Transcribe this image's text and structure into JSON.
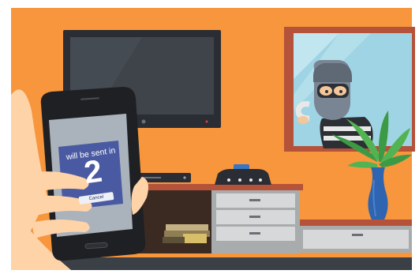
{
  "countdown": {
    "message": "will be sent in",
    "seconds": "2",
    "cancel_label": "Cancel"
  },
  "colors": {
    "wall": "#f7963c",
    "floor": "#3a4046",
    "tv_frame": "#2a2d33",
    "window_frame": "#b4523a",
    "window_glass": "#9fd4e4",
    "cabinet": "#c9cbcc",
    "plant": "#4aa64a",
    "vase": "#2f64b0",
    "phone_screen": "#aab3bc",
    "alert_panel": "#4a5aa2",
    "hand": "#ffd3a8"
  },
  "icons": {
    "intruder": "burglar-figure",
    "router": "router-icon",
    "plant": "plant-icon"
  }
}
